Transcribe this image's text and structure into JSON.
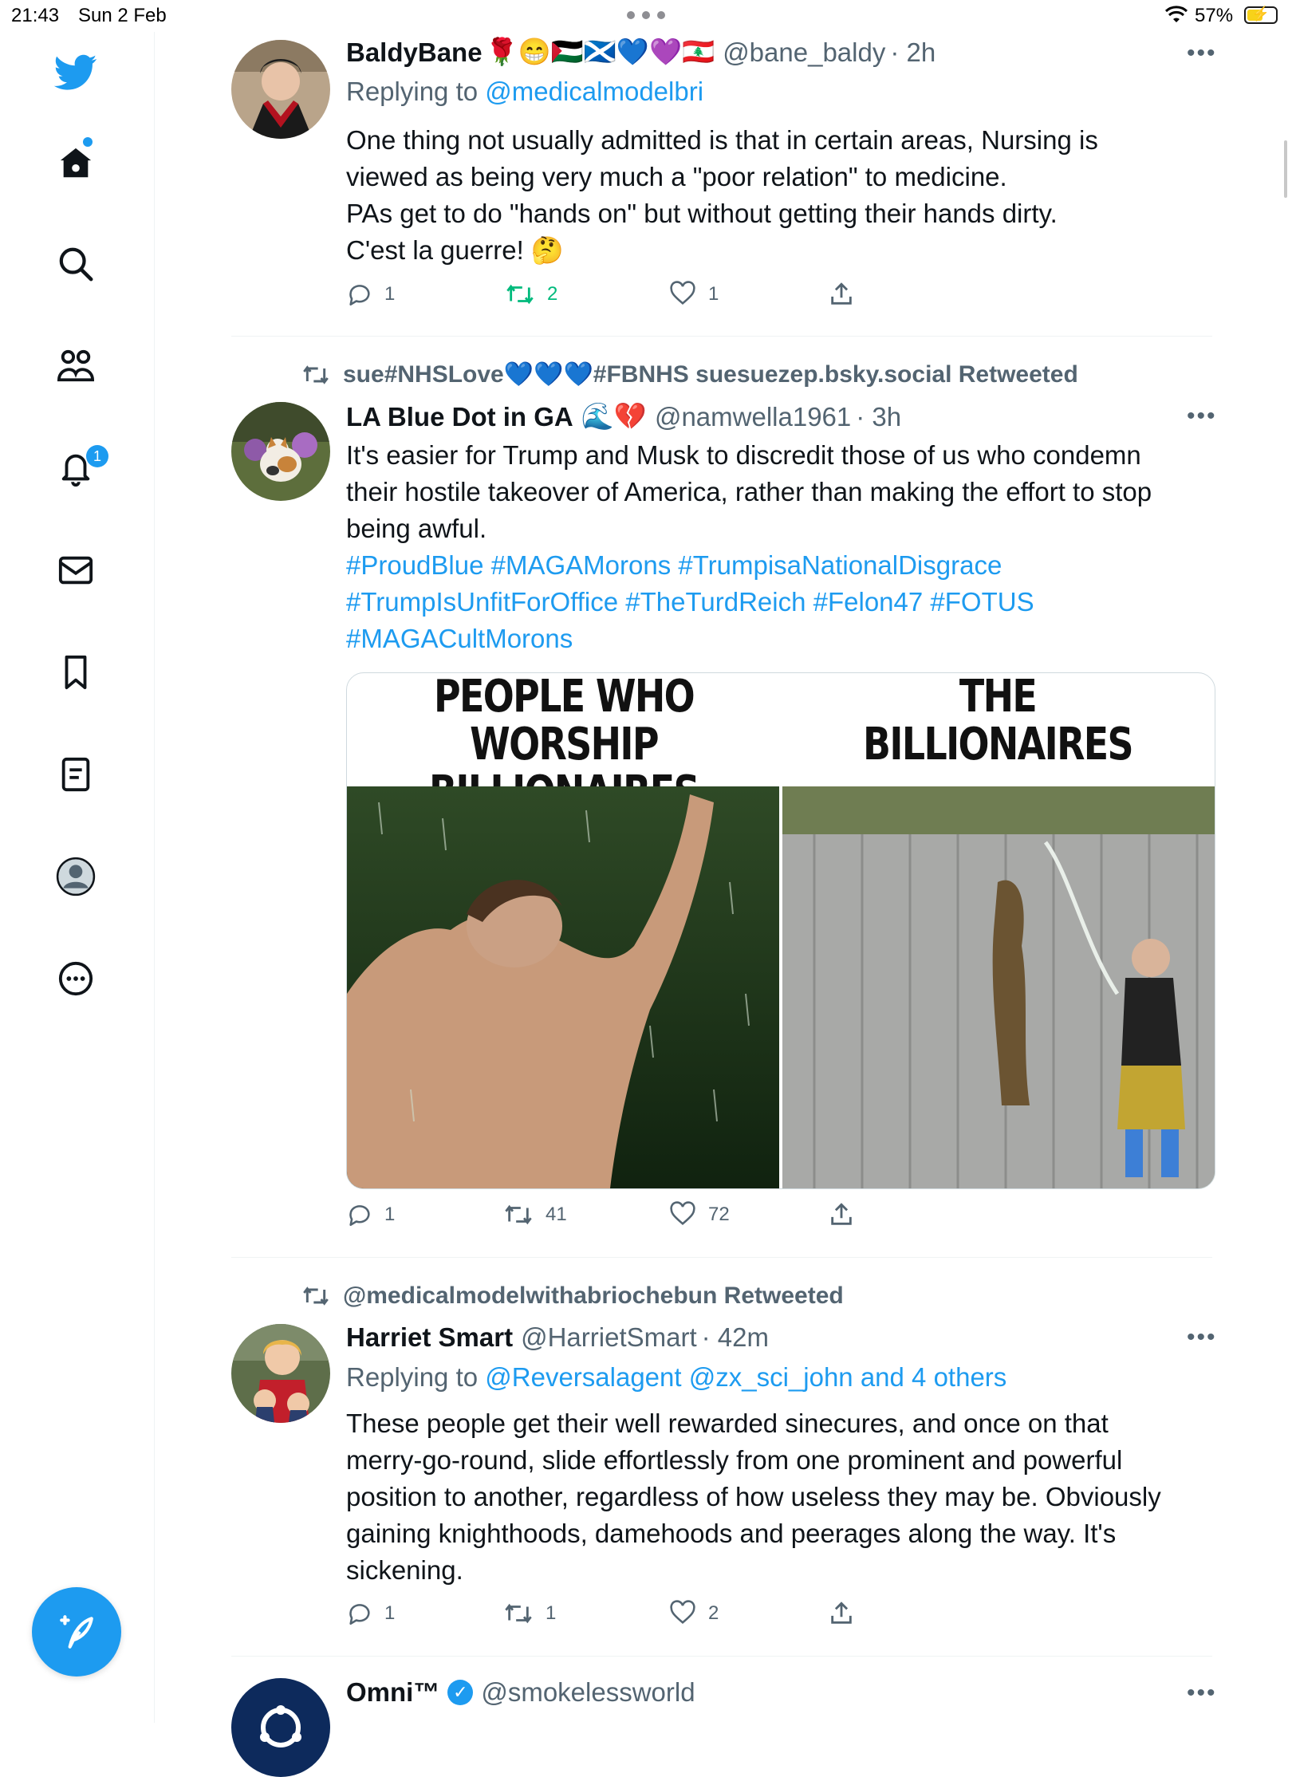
{
  "status_bar": {
    "time": "21:43",
    "date": "Sun 2 Feb",
    "battery": "57%",
    "battery_level": 0.57
  },
  "sidebar": {
    "notification_count": "1",
    "items": [
      "home-icon",
      "search-icon",
      "communities-icon",
      "notifications-icon",
      "messages-icon",
      "bookmarks-icon",
      "lists-icon",
      "profile-icon",
      "more-icon"
    ],
    "compose_icon": "compose-tweet-icon"
  },
  "colors": {
    "accent": "#1d9bf0",
    "retweet": "#00ba7c",
    "muted": "#536471"
  },
  "tweets": [
    {
      "name": "BaldyBane",
      "emoji": "🌹😁🇵🇸🏴󠁧󠁢󠁳󠁣󠁴󠁿💙💜🇱🇧",
      "handle": "@bane_baldy",
      "time": "· 2h",
      "reply_prefix": "Replying to ",
      "reply_to": "@medicalmodelbri",
      "lines": [
        "One thing not usually admitted is that in certain areas, Nursing is",
        "viewed as being very much a \"poor relation\" to medicine.",
        "PAs get to do \"hands on\" but without getting their hands dirty.",
        "C'est la guerre! 🤔"
      ],
      "replies": "1",
      "retweets": "2",
      "likes": "1"
    },
    {
      "retweeted_by": "sue#NHSLove💙💙💙#FBNHS suesuezep.bsky.social Retweeted",
      "name": "LA Blue Dot in GA",
      "emoji": "🌊💔",
      "handle": "@namwella1961",
      "time": "· 3h",
      "lines": [
        "It's easier for Trump and Musk to discredit those of us who condemn",
        "their hostile takeover of America, rather than making the effort to stop",
        "being awful."
      ],
      "hashtag_lines": [
        "#ProudBlue #MAGAMorons #TrumpisaNationalDisgrace",
        "#TrumpIsUnfitForOffice #TheTurdReich #Felon47 #FOTUS",
        "#MAGACultMorons"
      ],
      "media": {
        "left_caption_1": "PEOPLE WHO",
        "left_caption_2": "WORSHIP BILLIONAIRES",
        "right_caption_1": "THE",
        "right_caption_2": "BILLIONAIRES"
      },
      "replies": "1",
      "retweets": "41",
      "likes": "72"
    },
    {
      "retweeted_by": "@medicalmodelwithabriochebun Retweeted",
      "name": "Harriet Smart",
      "handle": "@HarrietSmart",
      "time": "· 42m",
      "reply_prefix": "Replying to ",
      "reply_to": "@Reversalagent @zx_sci_john and 4 others",
      "lines": [
        "These people get their well rewarded sinecures, and once on that",
        "merry-go-round, slide effortlessly from one prominent and powerful",
        "position to another, regardless of how useless they may be. Obviously",
        "gaining knighthoods, damehoods and peerages along the way. It's",
        "sickening."
      ],
      "replies": "1",
      "retweets": "1",
      "likes": "2"
    },
    {
      "name": "Omni™",
      "handle": "@smokelessworld",
      "verified": true
    }
  ]
}
